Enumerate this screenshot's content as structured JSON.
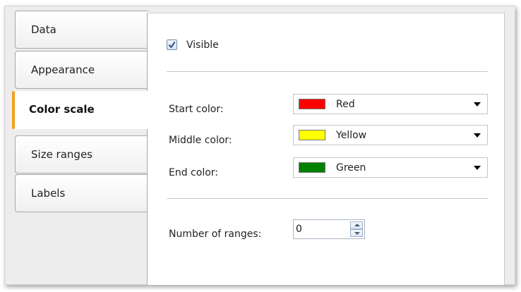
{
  "tabs": [
    {
      "label": "Data",
      "active": false
    },
    {
      "label": "Appearance",
      "active": false
    },
    {
      "label": "Color scale",
      "active": true
    },
    {
      "label": "Size ranges",
      "active": false
    },
    {
      "label": "Labels",
      "active": false
    }
  ],
  "panel": {
    "visible": {
      "label": "Visible",
      "checked": true
    },
    "start_color": {
      "label": "Start color:",
      "value": "Red",
      "swatch": "#ff0000"
    },
    "middle_color": {
      "label": "Middle color:",
      "value": "Yellow",
      "swatch": "#ffff00"
    },
    "end_color": {
      "label": "End color:",
      "value": "Green",
      "swatch": "#008000"
    },
    "ranges": {
      "label": "Number of ranges:",
      "value": "0"
    }
  },
  "colors": {
    "active_tab_accent": "#f0a020"
  }
}
